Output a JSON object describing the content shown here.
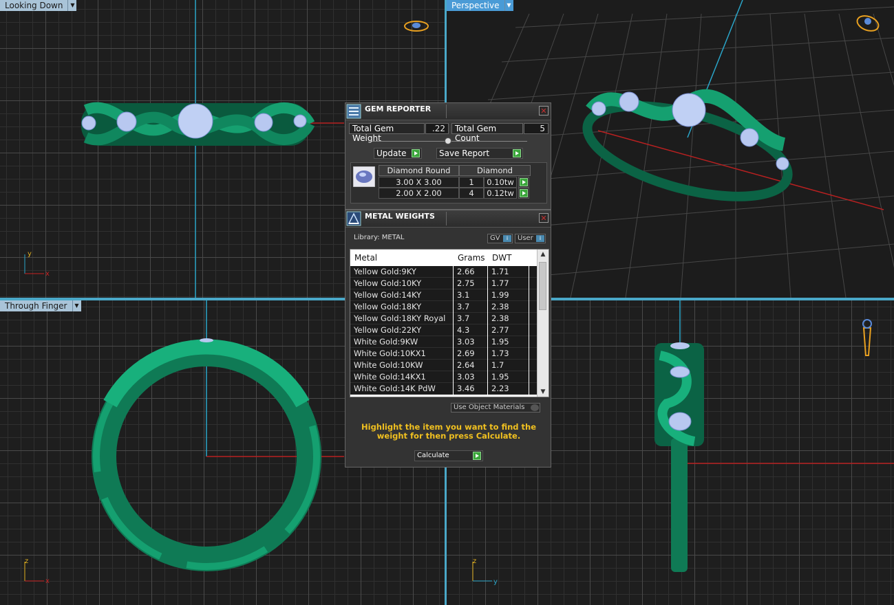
{
  "viewports": {
    "top_left": {
      "label": "Looking Down",
      "axis_v": "y",
      "axis_h": "x"
    },
    "top_right": {
      "label": "Perspective"
    },
    "bottom_left": {
      "label": "Through Finger",
      "axis_v": "z",
      "axis_h": "x"
    },
    "bottom_right": {
      "axis_v": "z",
      "axis_h": "y"
    }
  },
  "gem_reporter": {
    "title": "GEM REPORTER",
    "total_weight_label": "Total Gem Weight",
    "total_weight_value": ".22",
    "total_count_label": "Total Gem Count",
    "total_count_value": "5",
    "update_label": "Update",
    "save_label": "Save Report",
    "table": {
      "headers": [
        "Diamond Round",
        "Diamond"
      ],
      "rows": [
        {
          "size": "3.00 X 3.00",
          "count": "1",
          "weight": "0.10tw"
        },
        {
          "size": "2.00 X 2.00",
          "count": "4",
          "weight": "0.12tw"
        }
      ]
    }
  },
  "metal_weights": {
    "title": "METAL WEIGHTS",
    "library_label": "Library: METAL",
    "gv_label": "GV",
    "user_label": "User",
    "columns": [
      "Metal",
      "Grams",
      "DWT"
    ],
    "rows": [
      {
        "metal": "Yellow Gold:9KY",
        "grams": "2.66",
        "dwt": "1.71"
      },
      {
        "metal": "Yellow Gold:10KY",
        "grams": "2.75",
        "dwt": "1.77"
      },
      {
        "metal": "Yellow Gold:14KY",
        "grams": "3.1",
        "dwt": "1.99"
      },
      {
        "metal": "Yellow Gold:18KY",
        "grams": "3.7",
        "dwt": "2.38"
      },
      {
        "metal": "Yellow Gold:18KY Royal",
        "grams": "3.7",
        "dwt": "2.38"
      },
      {
        "metal": "Yellow Gold:22KY",
        "grams": "4.3",
        "dwt": "2.77"
      },
      {
        "metal": "White Gold:9KW",
        "grams": "3.03",
        "dwt": "1.95"
      },
      {
        "metal": "White Gold:10KX1",
        "grams": "2.69",
        "dwt": "1.73"
      },
      {
        "metal": "White Gold:10KW",
        "grams": "2.64",
        "dwt": "1.7"
      },
      {
        "metal": "White Gold:14KX1",
        "grams": "3.03",
        "dwt": "1.95"
      },
      {
        "metal": "White Gold:14K PdW",
        "grams": "3.46",
        "dwt": "2.23"
      }
    ],
    "use_object_materials_label": "Use Object Materials",
    "hint": "Highlight the item you want to find the weight for then press Calculate.",
    "calculate_label": "Calculate"
  },
  "colors": {
    "ring": "#0f7a55",
    "gem": "#b8c8f0",
    "accent": "#4aa8c8",
    "hint": "#f0c020"
  }
}
